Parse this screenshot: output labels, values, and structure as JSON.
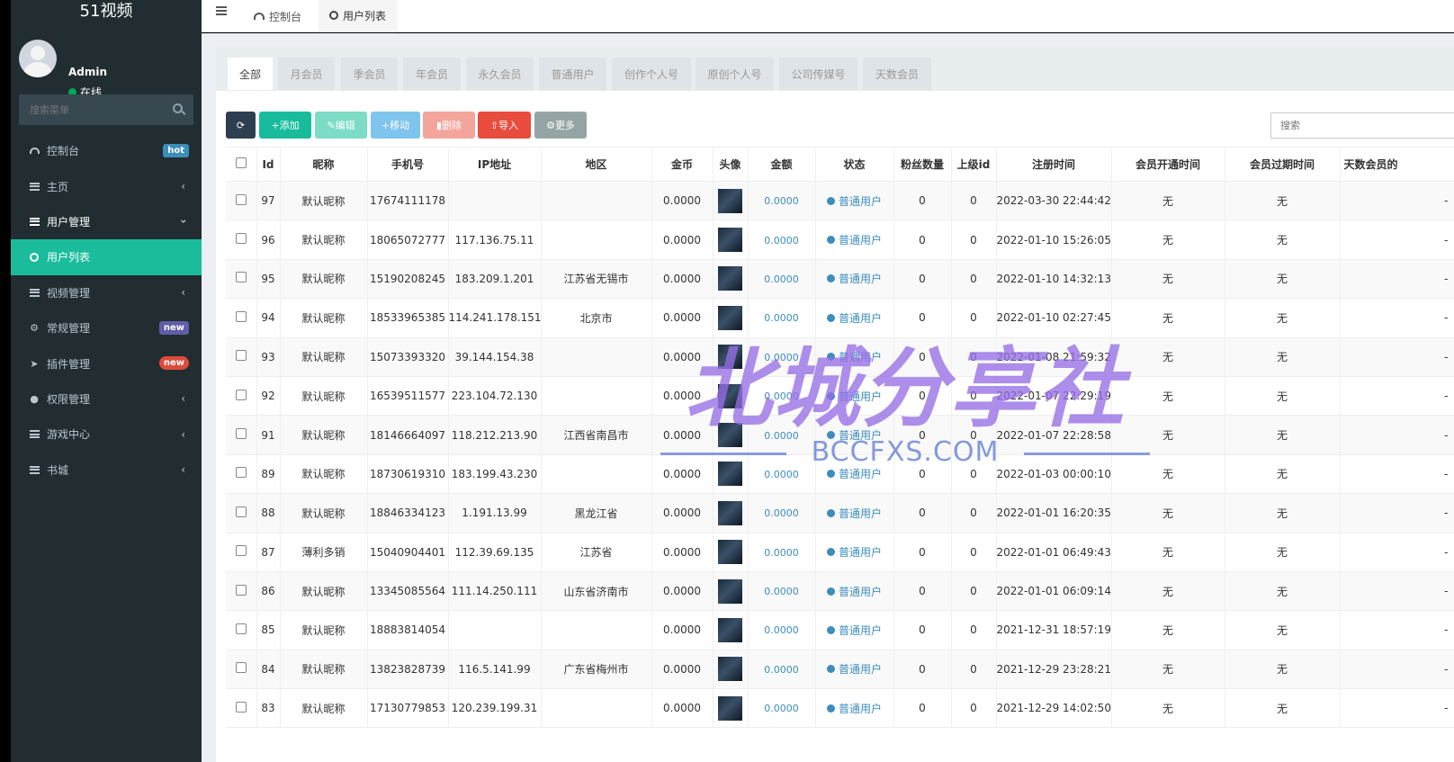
{
  "app": {
    "title": "51视频"
  },
  "user": {
    "name": "Admin",
    "status": "在线"
  },
  "sidebar": {
    "search_placeholder": "搜索菜单",
    "items": [
      {
        "label": "控制台",
        "icon": "gauge-icon",
        "badge": "hot"
      },
      {
        "label": "主页",
        "icon": "list-icon"
      },
      {
        "label": "用户管理",
        "icon": "list-icon"
      },
      {
        "label": "用户列表",
        "icon": "circle-icon"
      },
      {
        "label": "视频管理",
        "icon": "list-icon"
      },
      {
        "label": "常规管理",
        "icon": "cogs-icon",
        "badge": "new"
      },
      {
        "label": "插件管理",
        "icon": "rocket-icon",
        "badge": "new"
      },
      {
        "label": "权限管理",
        "icon": "group-icon"
      },
      {
        "label": "游戏中心",
        "icon": "list-icon"
      },
      {
        "label": "书城",
        "icon": "list-icon"
      }
    ]
  },
  "topbar": {
    "tabs": [
      {
        "label": "控制台"
      },
      {
        "label": "用户列表"
      }
    ]
  },
  "filters": [
    "全部",
    "月会员",
    "季会员",
    "年会员",
    "永久会员",
    "普通用户",
    "创作个人号",
    "原创个人号",
    "公司传媒号",
    "天数会员"
  ],
  "toolbar": {
    "add": "+添加",
    "edit": "编辑",
    "move": "+移动",
    "delete": "删除",
    "import": "导入",
    "more": "更多",
    "search_placeholder": "搜索"
  },
  "table": {
    "columns": [
      "Id",
      "昵称",
      "手机号",
      "IP地址",
      "地区",
      "金币",
      "头像",
      "金额",
      "状态",
      "粉丝数量",
      "上级id",
      "注册时间",
      "会员开通时间",
      "会员过期时间",
      "天数会员的"
    ],
    "rows": [
      {
        "id": "97",
        "nick": "默认昵称",
        "phone": "17674111178",
        "ip": "",
        "region": "",
        "coin": "0.0000",
        "amount": "0.0000",
        "status": "普通用户",
        "fans": "0",
        "parent": "0",
        "reg": "2022-03-30 22:44:42",
        "vip_open": "无",
        "vip_expire": "无",
        "days": "-"
      },
      {
        "id": "96",
        "nick": "默认昵称",
        "phone": "18065072777",
        "ip": "117.136.75.11",
        "region": "",
        "coin": "0.0000",
        "amount": "0.0000",
        "status": "普通用户",
        "fans": "0",
        "parent": "0",
        "reg": "2022-01-10 15:26:05",
        "vip_open": "无",
        "vip_expire": "无",
        "days": "-"
      },
      {
        "id": "95",
        "nick": "默认昵称",
        "phone": "15190208245",
        "ip": "183.209.1.201",
        "region": "江苏省无锡市",
        "coin": "0.0000",
        "amount": "0.0000",
        "status": "普通用户",
        "fans": "0",
        "parent": "0",
        "reg": "2022-01-10 14:32:13",
        "vip_open": "无",
        "vip_expire": "无",
        "days": "-"
      },
      {
        "id": "94",
        "nick": "默认昵称",
        "phone": "18533965385",
        "ip": "114.241.178.151",
        "region": "北京市",
        "coin": "0.0000",
        "amount": "0.0000",
        "status": "普通用户",
        "fans": "0",
        "parent": "0",
        "reg": "2022-01-10 02:27:45",
        "vip_open": "无",
        "vip_expire": "无",
        "days": "-"
      },
      {
        "id": "93",
        "nick": "默认昵称",
        "phone": "15073393320",
        "ip": "39.144.154.38",
        "region": "",
        "coin": "0.0000",
        "amount": "0.0000",
        "status": "普通用户",
        "fans": "0",
        "parent": "0",
        "reg": "2022-01-08 21:59:32",
        "vip_open": "无",
        "vip_expire": "无",
        "days": "-"
      },
      {
        "id": "92",
        "nick": "默认昵称",
        "phone": "16539511577",
        "ip": "223.104.72.130",
        "region": "",
        "coin": "0.0000",
        "amount": "0.0000",
        "status": "普通用户",
        "fans": "0",
        "parent": "0",
        "reg": "2022-01-07 22:29:19",
        "vip_open": "无",
        "vip_expire": "无",
        "days": "-"
      },
      {
        "id": "91",
        "nick": "默认昵称",
        "phone": "18146664097",
        "ip": "118.212.213.90",
        "region": "江西省南昌市",
        "coin": "0.0000",
        "amount": "0.0000",
        "status": "普通用户",
        "fans": "0",
        "parent": "0",
        "reg": "2022-01-07 22:28:58",
        "vip_open": "无",
        "vip_expire": "无",
        "days": "-"
      },
      {
        "id": "89",
        "nick": "默认昵称",
        "phone": "18730619310",
        "ip": "183.199.43.230",
        "region": "",
        "coin": "0.0000",
        "amount": "0.0000",
        "status": "普通用户",
        "fans": "0",
        "parent": "0",
        "reg": "2022-01-03 00:00:10",
        "vip_open": "无",
        "vip_expire": "无",
        "days": "-"
      },
      {
        "id": "88",
        "nick": "默认昵称",
        "phone": "18846334123",
        "ip": "1.191.13.99",
        "region": "黑龙江省",
        "coin": "0.0000",
        "amount": "0.0000",
        "status": "普通用户",
        "fans": "0",
        "parent": "0",
        "reg": "2022-01-01 16:20:35",
        "vip_open": "无",
        "vip_expire": "无",
        "days": "-"
      },
      {
        "id": "87",
        "nick": "薄利多销",
        "phone": "15040904401",
        "ip": "112.39.69.135",
        "region": "江苏省",
        "coin": "0.0000",
        "amount": "0.0000",
        "status": "普通用户",
        "fans": "0",
        "parent": "0",
        "reg": "2022-01-01 06:49:43",
        "vip_open": "无",
        "vip_expire": "无",
        "days": "-"
      },
      {
        "id": "86",
        "nick": "默认昵称",
        "phone": "13345085564",
        "ip": "111.14.250.111",
        "region": "山东省济南市",
        "coin": "0.0000",
        "amount": "0.0000",
        "status": "普通用户",
        "fans": "0",
        "parent": "0",
        "reg": "2022-01-01 06:09:14",
        "vip_open": "无",
        "vip_expire": "无",
        "days": "-"
      },
      {
        "id": "85",
        "nick": "默认昵称",
        "phone": "18883814054",
        "ip": "",
        "region": "",
        "coin": "0.0000",
        "amount": "0.0000",
        "status": "普通用户",
        "fans": "0",
        "parent": "0",
        "reg": "2021-12-31 18:57:19",
        "vip_open": "无",
        "vip_expire": "无",
        "days": "-"
      },
      {
        "id": "84",
        "nick": "默认昵称",
        "phone": "13823828739",
        "ip": "116.5.141.99",
        "region": "广东省梅州市",
        "coin": "0.0000",
        "amount": "0.0000",
        "status": "普通用户",
        "fans": "0",
        "parent": "0",
        "reg": "2021-12-29 23:28:21",
        "vip_open": "无",
        "vip_expire": "无",
        "days": "-"
      },
      {
        "id": "83",
        "nick": "默认昵称",
        "phone": "17130779853",
        "ip": "120.239.199.31",
        "region": "",
        "coin": "0.0000",
        "amount": "0.0000",
        "status": "普通用户",
        "fans": "0",
        "parent": "0",
        "reg": "2021-12-29 14:02:50",
        "vip_open": "无",
        "vip_expire": "无",
        "days": "-"
      }
    ]
  },
  "watermark": {
    "main": "北城分享社",
    "sub": "BCCFXS.COM"
  },
  "colors": {
    "sidebar_bg": "#222d32",
    "active_item": "#1abc9c",
    "link_blue": "#3c8dbc",
    "hot_badge": "#3c8dbc",
    "new_badge_blue": "#605ca8",
    "new_badge_red": "#dd4b39"
  }
}
